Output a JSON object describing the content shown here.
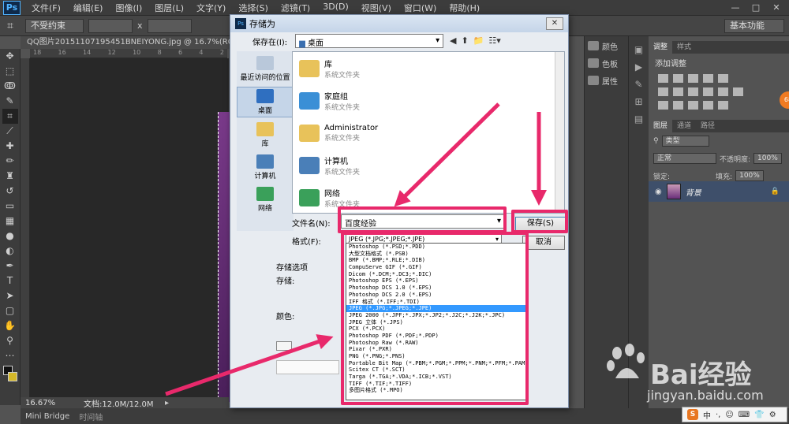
{
  "app": {
    "logo": "Ps",
    "menu": [
      "文件(F)",
      "编辑(E)",
      "图像(I)",
      "图层(L)",
      "文字(Y)",
      "选择(S)",
      "滤镜(T)",
      "3D(D)",
      "视图(V)",
      "窗口(W)",
      "帮助(H)"
    ],
    "window_buttons": [
      "—",
      "□",
      "✕"
    ]
  },
  "options_bar": {
    "constraint": "不受约束",
    "x_sep": "x",
    "workspace": "基本功能"
  },
  "document": {
    "tab_title": "QQ图片20151107195451BNEIYONG.jpg @ 16.7%(RGB/8#) *",
    "ruler_ticks": [
      "18",
      "16",
      "14",
      "12",
      "10",
      "8",
      "6",
      "4",
      "2"
    ],
    "zoom": "16.67%",
    "doc_size": "文档:12.0M/12.0M"
  },
  "bottom_tabs": [
    "Mini Bridge",
    "时间轴"
  ],
  "mid_dock": {
    "items": [
      "颜色",
      "色板",
      "属性"
    ]
  },
  "right_panel": {
    "top_tabs": [
      "调整",
      "样式"
    ],
    "adjust_title": "添加调整",
    "layers_tabs": [
      "图层",
      "通道",
      "路径"
    ],
    "kind_label": "类型",
    "blend_mode": "正常",
    "opacity_label": "不透明度:",
    "opacity_value": "100%",
    "lock_label": "锁定:",
    "fill_label": "填充:",
    "fill_value": "100%",
    "layer_name": "背景",
    "badge": "68"
  },
  "dialog": {
    "title": "存储为",
    "save_in_label": "保存在(I):",
    "save_in_value": "桌面",
    "places": [
      "最近访问的位置",
      "桌面",
      "库",
      "计算机",
      "网络"
    ],
    "files": [
      {
        "name": "库",
        "type": "系统文件夹",
        "color": "#e8c25a"
      },
      {
        "name": "家庭组",
        "type": "系统文件夹",
        "color": "#3a8fd6"
      },
      {
        "name": "Administrator",
        "type": "系统文件夹",
        "color": "#e8c25a"
      },
      {
        "name": "计算机",
        "type": "系统文件夹",
        "color": "#4a7fb8"
      },
      {
        "name": "网络",
        "type": "系统文件夹",
        "color": "#3aa05a"
      }
    ],
    "filename_label": "文件名(N):",
    "filename_value": "百度经验",
    "format_label": "格式(F):",
    "format_value": "JPEG (*.JPG;*.JPEG;*.JPE)",
    "save_button": "保存(S)",
    "cancel_button": "取消",
    "options_title": "存储选项",
    "save_label": "存储:",
    "color_label": "颜色:"
  },
  "format_list": [
    "Photoshop (*.PSD;*.PDD)",
    "大型文档格式 (*.PSB)",
    "BMP (*.BMP;*.RLE;*.DIB)",
    "CompuServe GIF (*.GIF)",
    "Dicom (*.DCM;*.DC3;*.DIC)",
    "Photoshop EPS (*.EPS)",
    "Photoshop DCS 1.0 (*.EPS)",
    "Photoshop DCS 2.0 (*.EPS)",
    "IFF 格式 (*.IFF;*.TDI)",
    "JPEG (*.JPG;*.JPEG;*.JPE)",
    "JPEG 2000 (*.JPF;*.JPX;*.JP2;*.J2C;*.J2K;*.JPC)",
    "JPEG 立体 (*.JPS)",
    "PCX (*.PCX)",
    "Photoshop PDF (*.PDF;*.PDP)",
    "Photoshop Raw (*.RAW)",
    "Pixar (*.PXR)",
    "PNG (*.PNG;*.PNS)",
    "Portable Bit Map (*.PBM;*.PGM;*.PPM;*.PNM;*.PFM;*.PAM)",
    "Scitex CT (*.SCT)",
    "Targa (*.TGA;*.VDA;*.ICB;*.VST)",
    "TIFF (*.TIF;*.TIFF)",
    "多图片格式 (*.MPO)"
  ],
  "format_selected_index": 9,
  "watermark": {
    "brand": "Bai经验",
    "url": "jingyan.baidu.com"
  },
  "ime": {
    "logo": "S",
    "items": [
      "中",
      "·,",
      "☺",
      "⌨",
      "👕",
      "⚙"
    ]
  },
  "colors": {
    "highlight": "#e8296b",
    "selection": "#3399ff",
    "accent_ps": "#4fb3ff"
  }
}
